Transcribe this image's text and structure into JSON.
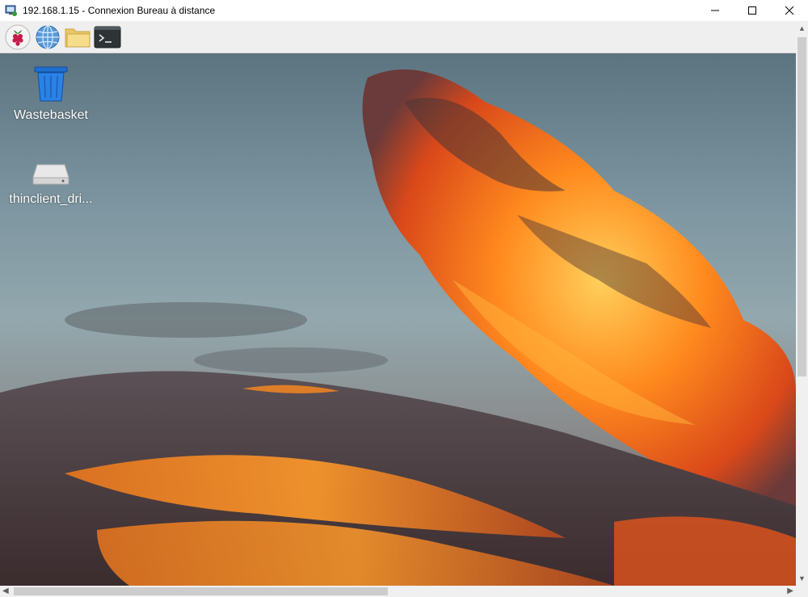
{
  "window": {
    "title": "192.168.1.15 - Connexion Bureau à distance",
    "controls": [
      "minimize-icon",
      "maximize-icon",
      "close-icon"
    ]
  },
  "panel": {
    "launchers": [
      {
        "name": "raspberry-menu",
        "icon": "raspberry-icon"
      },
      {
        "name": "web-browser",
        "icon": "globe-icon"
      },
      {
        "name": "file-manager",
        "icon": "folder-icon"
      },
      {
        "name": "terminal",
        "icon": "terminal-icon"
      }
    ]
  },
  "desktop": {
    "icons": [
      {
        "label": "Wastebasket",
        "icon": "trash-icon"
      },
      {
        "label": "thinclient_dri...",
        "icon": "drive-icon"
      }
    ]
  },
  "scrollbars": {
    "vertical": {
      "up": "▲",
      "down": "▼"
    },
    "horizontal": {
      "left": "◀",
      "right": "▶"
    }
  },
  "colors": {
    "sky": "#7f97a2",
    "cloud_orange": "#ff7a1a",
    "cloud_dark": "#4a3a3a",
    "panel_bg": "#efefef"
  }
}
